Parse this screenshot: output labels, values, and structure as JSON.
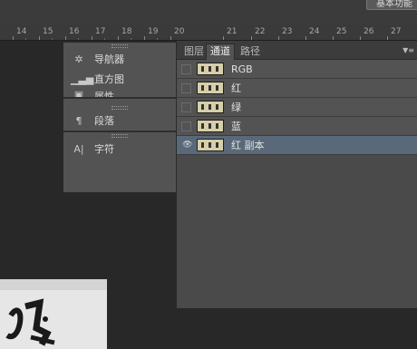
{
  "topbar": {
    "button_label": "基本功能"
  },
  "ruler": {
    "ticks": [
      "14",
      "15",
      "16",
      "17",
      "18",
      "19",
      "20",
      "21",
      "22",
      "23",
      "24",
      "25",
      "26",
      "27"
    ]
  },
  "dock": {
    "groups": [
      {
        "items": [
          {
            "label": "导航器",
            "icon": "navigator-icon"
          },
          {
            "label": "直方图",
            "icon": "histogram-icon"
          },
          {
            "label": "属性",
            "icon": "properties-icon"
          }
        ]
      },
      {
        "items": [
          {
            "label": "段落",
            "icon": "paragraph-icon"
          }
        ]
      },
      {
        "items": [
          {
            "label": "字符",
            "icon": "character-icon"
          }
        ]
      }
    ]
  },
  "panel": {
    "tabs": [
      "图层",
      "通道",
      "路径"
    ],
    "active_tab": "通道",
    "channels": [
      {
        "label": "RGB",
        "visible": false,
        "selected": false
      },
      {
        "label": "红",
        "visible": false,
        "selected": false
      },
      {
        "label": "绿",
        "visible": false,
        "selected": false
      },
      {
        "label": "蓝",
        "visible": false,
        "selected": false
      },
      {
        "label": "红 副本",
        "visible": true,
        "selected": true
      }
    ]
  },
  "colors": {
    "selected_row": "#596979",
    "panel_bg": "#535353",
    "canvas_bg": "#282828"
  }
}
